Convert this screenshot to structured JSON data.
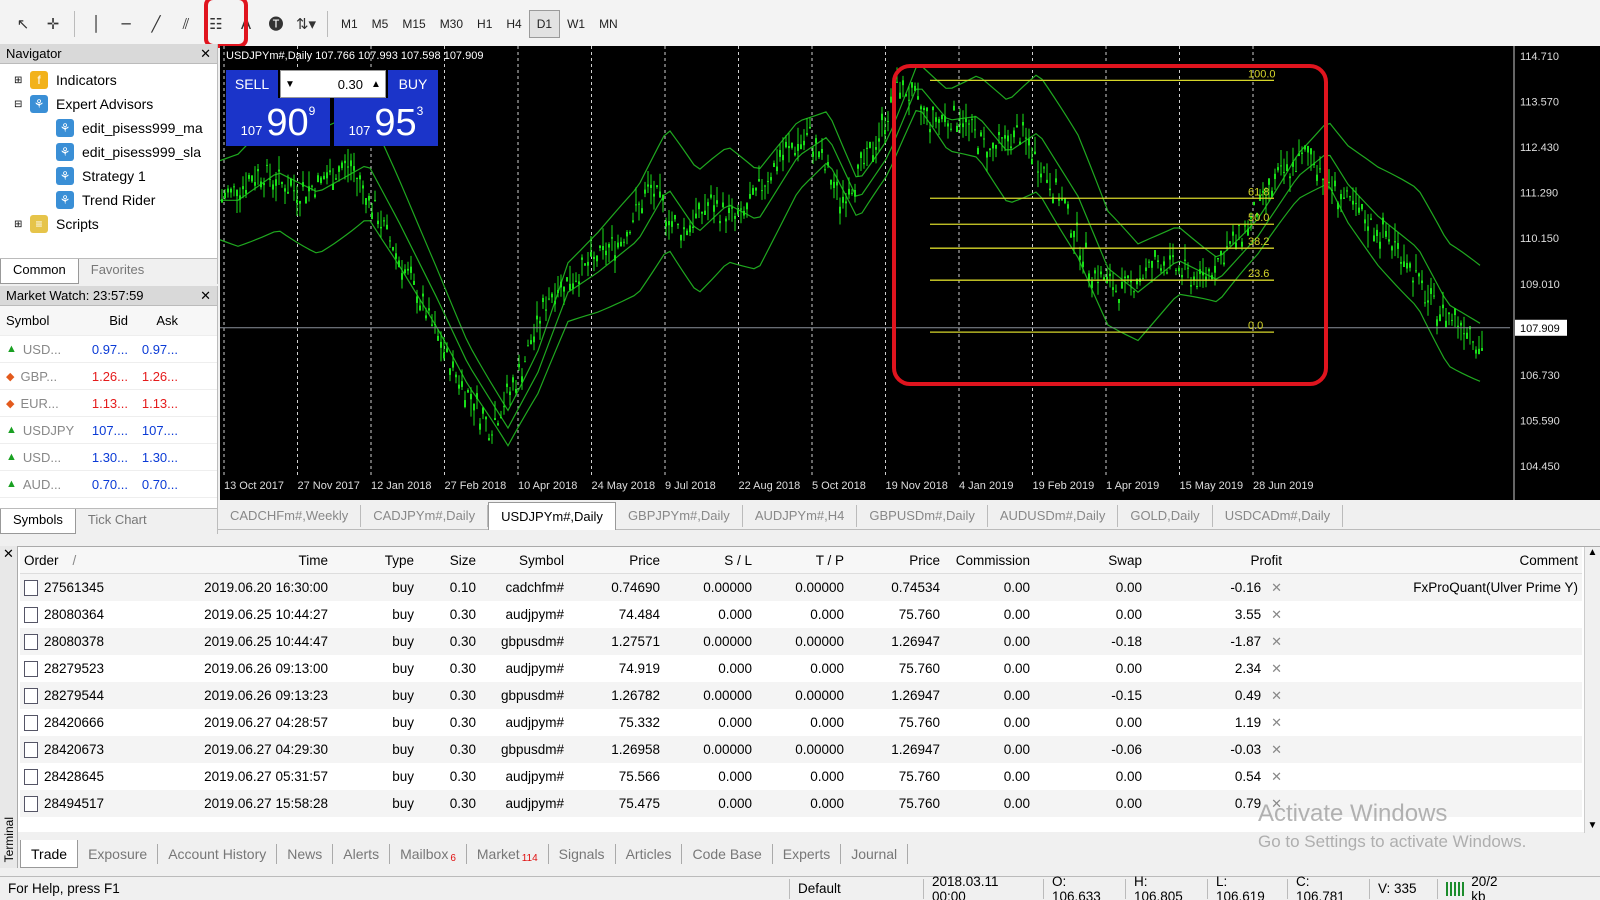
{
  "toolbar": {
    "timeframes": [
      "M1",
      "M5",
      "M15",
      "M30",
      "H1",
      "H4",
      "D1",
      "W1",
      "MN"
    ],
    "active_timeframe": "D1"
  },
  "navigator": {
    "title": "Navigator",
    "items": [
      {
        "label": "Indicators",
        "icon": "indicators-icon"
      },
      {
        "label": "Expert Advisors",
        "icon": "expert-advisors-icon"
      },
      {
        "label": "edit_pisess999_ma",
        "icon": "ea-hat-icon"
      },
      {
        "label": "edit_pisess999_sla",
        "icon": "ea-hat-icon"
      },
      {
        "label": "Strategy 1",
        "icon": "ea-hat-icon"
      },
      {
        "label": "Trend Rider",
        "icon": "ea-hat-icon"
      },
      {
        "label": "Scripts",
        "icon": "scripts-icon"
      }
    ],
    "tabs": [
      "Common",
      "Favorites"
    ]
  },
  "market_watch": {
    "title": "Market Watch: 23:57:59",
    "headers": [
      "Symbol",
      "Bid",
      "Ask"
    ],
    "rows": [
      {
        "symbol": "USD...",
        "bid": "0.97...",
        "ask": "0.97...",
        "dir": "up",
        "color": "#0a3ad6"
      },
      {
        "symbol": "GBP...",
        "bid": "1.26...",
        "ask": "1.26...",
        "dir": "down",
        "color": "#e51b1b"
      },
      {
        "symbol": "EUR...",
        "bid": "1.13...",
        "ask": "1.13...",
        "dir": "down",
        "color": "#e51b1b"
      },
      {
        "symbol": "USDJPY",
        "bid": "107....",
        "ask": "107....",
        "dir": "up",
        "color": "#0a3ad6"
      },
      {
        "symbol": "USD...",
        "bid": "1.30...",
        "ask": "1.30...",
        "dir": "up",
        "color": "#0a3ad6"
      },
      {
        "symbol": "AUD...",
        "bid": "0.70...",
        "ask": "0.70...",
        "dir": "up",
        "color": "#0a3ad6"
      }
    ],
    "tabs": [
      "Symbols",
      "Tick Chart"
    ]
  },
  "chart": {
    "title": "USDJPYm#,Daily  107.766 107.993 107.598 107.909",
    "sell_label": "SELL",
    "buy_label": "BUY",
    "lot": "0.30",
    "sell_price": {
      "small": "107",
      "big": "90",
      "sup": "9"
    },
    "buy_price": {
      "small": "107",
      "big": "95",
      "sup": "3"
    },
    "price_axis": [
      "114.710",
      "113.570",
      "112.430",
      "111.290",
      "110.150",
      "109.010",
      "107.909",
      "106.730",
      "105.590",
      "104.450"
    ],
    "current_price": "107.909",
    "date_axis": [
      "13 Oct 2017",
      "27 Nov 2017",
      "12 Jan 2018",
      "27 Feb 2018",
      "10 Apr 2018",
      "24 May 2018",
      "9 Jul 2018",
      "22 Aug 2018",
      "5 Oct 2018",
      "19 Nov 2018",
      "4 Jan 2019",
      "19 Feb 2019",
      "1 Apr 2019",
      "15 May 2019",
      "28 Jun 2019"
    ],
    "fibo_levels": [
      "100.0",
      "61.8",
      "50.0",
      "38.2",
      "23.6",
      "0.0"
    ],
    "candle_color": "#18e018",
    "band_color": "#1fa81f",
    "fibo_color": "#d6d62a",
    "highlight_color": "#e0141e"
  },
  "chart_tabs": [
    "CADCHFm#,Weekly",
    "CADJPYm#,Daily",
    "USDJPYm#,Daily",
    "GBPJPYm#,Daily",
    "AUDJPYm#,H4",
    "GBPUSDm#,Daily",
    "AUDUSDm#,Daily",
    "GOLD,Daily",
    "USDCADm#,Daily"
  ],
  "active_chart_tab": "USDJPYm#,Daily",
  "terminal": {
    "side_label": "Terminal",
    "headers": [
      "Order",
      "Time",
      "Type",
      "Size",
      "Symbol",
      "Price",
      "S / L",
      "T / P",
      "Price",
      "Commission",
      "Swap",
      "Profit",
      "Comment"
    ],
    "order_sort_mark": "/",
    "rows": [
      {
        "order": "27561345",
        "time": "2019.06.20 16:30:00",
        "type": "buy",
        "size": "0.10",
        "symbol": "cadchfm#",
        "price": "0.74690",
        "sl": "0.00000",
        "tp": "0.00000",
        "price2": "0.74534",
        "commission": "0.00",
        "swap": "0.00",
        "profit": "-0.16",
        "comment": "FxProQuant(Ulver Prime Y)"
      },
      {
        "order": "28080364",
        "time": "2019.06.25 10:44:27",
        "type": "buy",
        "size": "0.30",
        "symbol": "audjpym#",
        "price": "74.484",
        "sl": "0.000",
        "tp": "0.000",
        "price2": "75.760",
        "commission": "0.00",
        "swap": "0.00",
        "profit": "3.55",
        "comment": ""
      },
      {
        "order": "28080378",
        "time": "2019.06.25 10:44:47",
        "type": "buy",
        "size": "0.30",
        "symbol": "gbpusdm#",
        "price": "1.27571",
        "sl": "0.00000",
        "tp": "0.00000",
        "price2": "1.26947",
        "commission": "0.00",
        "swap": "-0.18",
        "profit": "-1.87",
        "comment": ""
      },
      {
        "order": "28279523",
        "time": "2019.06.26 09:13:00",
        "type": "buy",
        "size": "0.30",
        "symbol": "audjpym#",
        "price": "74.919",
        "sl": "0.000",
        "tp": "0.000",
        "price2": "75.760",
        "commission": "0.00",
        "swap": "0.00",
        "profit": "2.34",
        "comment": ""
      },
      {
        "order": "28279544",
        "time": "2019.06.26 09:13:23",
        "type": "buy",
        "size": "0.30",
        "symbol": "gbpusdm#",
        "price": "1.26782",
        "sl": "0.00000",
        "tp": "0.00000",
        "price2": "1.26947",
        "commission": "0.00",
        "swap": "-0.15",
        "profit": "0.49",
        "comment": ""
      },
      {
        "order": "28420666",
        "time": "2019.06.27 04:28:57",
        "type": "buy",
        "size": "0.30",
        "symbol": "audjpym#",
        "price": "75.332",
        "sl": "0.000",
        "tp": "0.000",
        "price2": "75.760",
        "commission": "0.00",
        "swap": "0.00",
        "profit": "1.19",
        "comment": ""
      },
      {
        "order": "28420673",
        "time": "2019.06.27 04:29:30",
        "type": "buy",
        "size": "0.30",
        "symbol": "gbpusdm#",
        "price": "1.26958",
        "sl": "0.00000",
        "tp": "0.00000",
        "price2": "1.26947",
        "commission": "0.00",
        "swap": "-0.06",
        "profit": "-0.03",
        "comment": ""
      },
      {
        "order": "28428645",
        "time": "2019.06.27 05:31:57",
        "type": "buy",
        "size": "0.30",
        "symbol": "audjpym#",
        "price": "75.566",
        "sl": "0.000",
        "tp": "0.000",
        "price2": "75.760",
        "commission": "0.00",
        "swap": "0.00",
        "profit": "0.54",
        "comment": ""
      },
      {
        "order": "28494517",
        "time": "2019.06.27 15:58:28",
        "type": "buy",
        "size": "0.30",
        "symbol": "audjpym#",
        "price": "75.475",
        "sl": "0.000",
        "tp": "0.000",
        "price2": "75.760",
        "commission": "0.00",
        "swap": "0.00",
        "profit": "0.79",
        "comment": ""
      }
    ],
    "tabs": [
      {
        "label": "Trade",
        "badge": ""
      },
      {
        "label": "Exposure",
        "badge": ""
      },
      {
        "label": "Account History",
        "badge": ""
      },
      {
        "label": "News",
        "badge": ""
      },
      {
        "label": "Alerts",
        "badge": ""
      },
      {
        "label": "Mailbox",
        "badge": "6"
      },
      {
        "label": "Market",
        "badge": "114"
      },
      {
        "label": "Signals",
        "badge": ""
      },
      {
        "label": "Articles",
        "badge": ""
      },
      {
        "label": "Code Base",
        "badge": ""
      },
      {
        "label": "Experts",
        "badge": ""
      },
      {
        "label": "Journal",
        "badge": ""
      }
    ]
  },
  "status_bar": {
    "help": "For Help, press F1",
    "profile": "Default",
    "datetime": "2018.03.11 00:00",
    "open": "O: 106.633",
    "high": "H: 106.805",
    "low": "L: 106.619",
    "close": "C: 106.781",
    "volume": "V: 335",
    "traffic": "20/2 kb"
  },
  "watermark": {
    "line1": "Activate Windows",
    "line2": "Go to Settings to activate Windows."
  }
}
